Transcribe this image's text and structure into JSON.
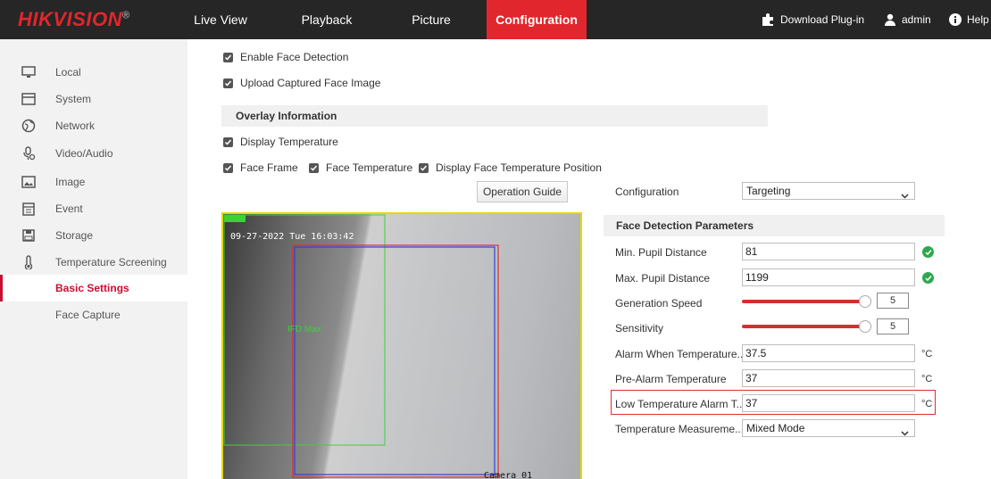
{
  "app": {
    "logo": "HIKVISION",
    "logo_reg": "®"
  },
  "nav": {
    "live_view": "Live View",
    "playback": "Playback",
    "picture": "Picture",
    "configuration": "Configuration"
  },
  "topright": {
    "download": "Download Plug-in",
    "user": "admin",
    "help": "Help"
  },
  "sidebar": {
    "items": [
      {
        "label": "Local",
        "icon": "monitor-icon"
      },
      {
        "label": "System",
        "icon": "window-icon"
      },
      {
        "label": "Network",
        "icon": "globe-icon"
      },
      {
        "label": "Video/Audio",
        "icon": "microphone-icon"
      },
      {
        "label": "Image",
        "icon": "image-icon"
      },
      {
        "label": "Event",
        "icon": "calendar-icon"
      },
      {
        "label": "Storage",
        "icon": "floppy-icon"
      },
      {
        "label": "Temperature Screening",
        "icon": "thermometer-icon"
      }
    ],
    "sub_items": [
      {
        "label": "Basic Settings",
        "active": true
      },
      {
        "label": "Face Capture",
        "active": false
      }
    ]
  },
  "options": {
    "enable_face_detection": "Enable Face Detection",
    "upload_face_image": "Upload Captured Face Image",
    "overlay_title": "Overlay Information",
    "display_temperature": "Display Temperature",
    "face_frame": "Face Frame",
    "face_temperature": "Face Temperature",
    "display_face_temp_position": "Display Face Temperature Position",
    "operation_guide": "Operation Guide"
  },
  "video": {
    "timestamp": "09-27-2022 Tue 16:03:42",
    "camera": "Camera 01",
    "region_label": "IFD Max"
  },
  "params": {
    "configuration_label": "Configuration",
    "configuration_value": "Targeting",
    "section_title": "Face Detection Parameters",
    "min_pupil_label": "Min. Pupil Distance",
    "min_pupil_value": "81",
    "max_pupil_label": "Max. Pupil Distance",
    "max_pupil_value": "1199",
    "gen_speed_label": "Generation Speed",
    "gen_speed_value": "5",
    "sensitivity_label": "Sensitivity",
    "sensitivity_value": "5",
    "alarm_temp_label": "Alarm When Temperature...",
    "alarm_temp_value": "37.5",
    "pre_alarm_label": "Pre-Alarm Temperature",
    "pre_alarm_value": "37",
    "low_temp_label": "Low Temperature Alarm T...",
    "low_temp_value": "37",
    "measure_label": "Temperature Measureme...",
    "measure_value": "Mixed Mode",
    "unit": "°C"
  },
  "colors": {
    "accent": "#e1262d",
    "topbar": "#262626",
    "sidebar": "#f2f2f2",
    "ok": "#2fa84f"
  }
}
